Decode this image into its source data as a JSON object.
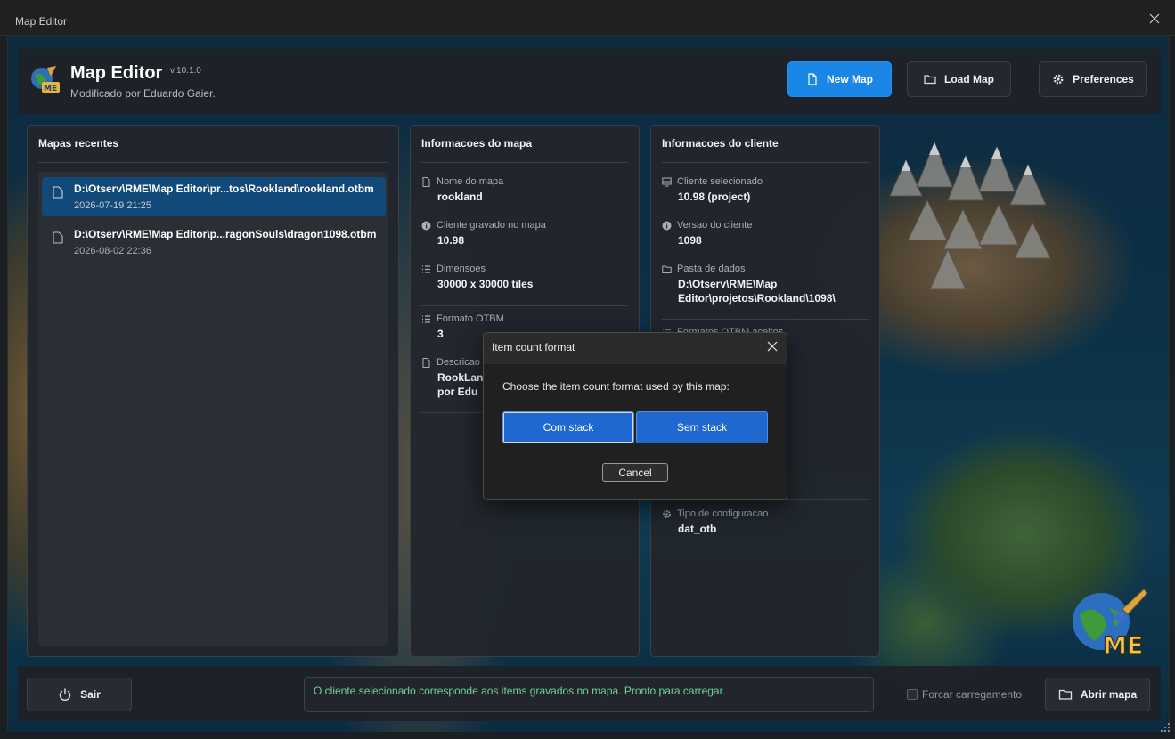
{
  "window": {
    "title": "Map Editor"
  },
  "header": {
    "app_title": "Map Editor",
    "version": "v.10.1.0",
    "subtitle": "Modificado por Eduardo Gaier.",
    "logo_text": "ME",
    "buttons": {
      "new_map": "New Map",
      "load_map": "Load Map",
      "preferences": "Preferences"
    }
  },
  "recent": {
    "title": "Mapas recentes",
    "items": [
      {
        "path": "D:\\Otserv\\RME\\Map Editor\\pr...tos\\Rookland\\rookland.otbm",
        "date": "2026-07-19 21:25",
        "selected": true
      },
      {
        "path": "D:\\Otserv\\RME\\Map Editor\\p...ragonSouls\\dragon1098.otbm",
        "date": "2026-08-02 22:36",
        "selected": false
      }
    ]
  },
  "map_info": {
    "title": "Informacoes do mapa",
    "fields": [
      {
        "label": "Nome do mapa",
        "value": "rookland",
        "icon": "document-icon"
      },
      {
        "label": "Cliente gravado no mapa",
        "value": "10.98",
        "icon": "info-icon"
      },
      {
        "label": "Dimensoes",
        "value": "30000 x 30000 tiles",
        "icon": "list-icon"
      },
      {
        "label": "Formato OTBM",
        "value": "3",
        "icon": "list-icon"
      },
      {
        "label": "Descricao",
        "value_line1": "RookLand",
        "value_line2": "por Edu",
        "icon": "document-icon"
      }
    ]
  },
  "client_info": {
    "title": "Informacoes do cliente",
    "fields": [
      {
        "label": "Cliente selecionado",
        "value": "10.98 (project)",
        "icon": "monitor-icon"
      },
      {
        "label": "Versao do cliente",
        "value": "1098",
        "icon": "info-icon"
      },
      {
        "label": "Pasta de dados",
        "value_line1": "D:\\Otserv\\RME\\Map",
        "value_line2": "Editor\\projetos\\Rookland\\1098\\",
        "icon": "folder-icon"
      },
      {
        "label": "Formatos OTBM aceitos",
        "icon": "list-icon"
      },
      {
        "label": "Tipo de configuracao",
        "value": "dat_otb",
        "icon": "gear-icon"
      }
    ]
  },
  "footer": {
    "exit_label": "Sair",
    "status_text": "O cliente selecionado corresponde aos items gravados no mapa. Pronto para carregar.",
    "force_load_label": "Forcar carregamento",
    "force_load_checked": false,
    "open_map_label": "Abrir mapa"
  },
  "dialog": {
    "title": "Item count format",
    "prompt": "Choose the item count format used by this map:",
    "option_with_stack": "Com stack",
    "option_without_stack": "Sem stack",
    "cancel": "Cancel"
  },
  "colors": {
    "accent": "#1a86e6",
    "dialog_button": "#1f68d0",
    "status_ok": "#6ed49a",
    "selected_row": "#114a78"
  }
}
